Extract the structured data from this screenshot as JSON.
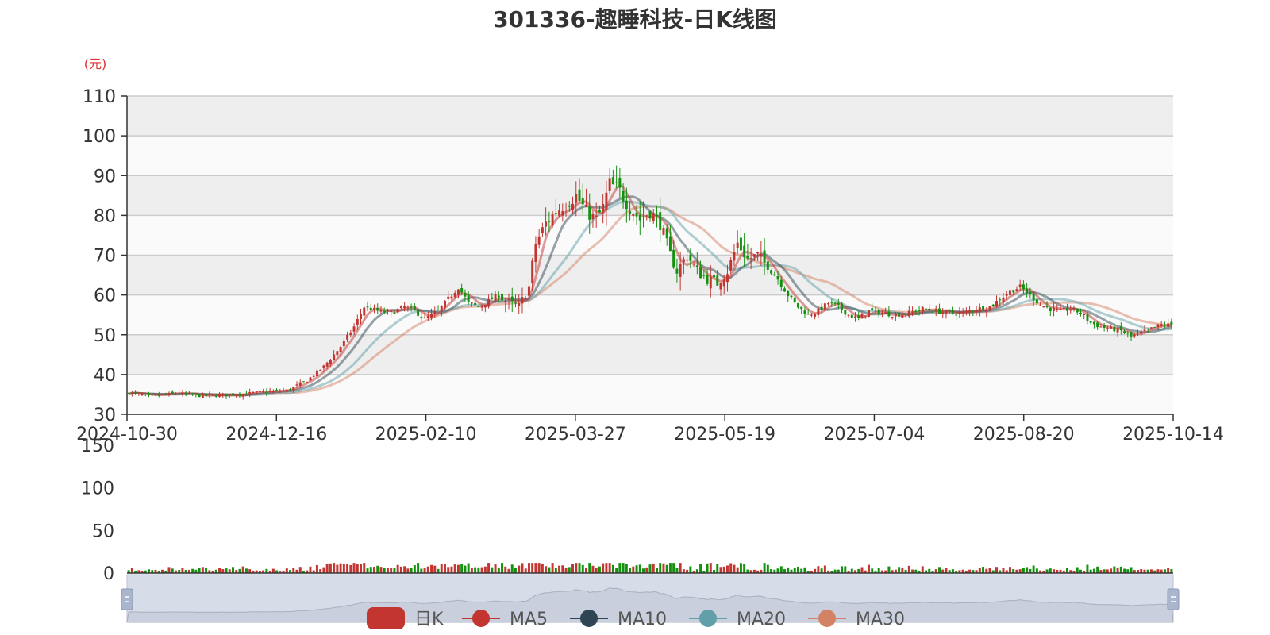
{
  "chart_data": {
    "type": "candlestick",
    "title": "301336-趣睡科技-日K线图",
    "yunit": "(元)",
    "ylim": [
      30,
      110
    ],
    "yticks": [
      30,
      40,
      50,
      60,
      70,
      80,
      90,
      100,
      110
    ],
    "x_ticks": [
      "2024-10-30",
      "2024-12-16",
      "2025-02-10",
      "2025-03-27",
      "2025-05-19",
      "2025-07-04",
      "2025-08-20",
      "2025-10-14"
    ],
    "volume_ylim": [
      0,
      150
    ],
    "volume_yticks": [
      0,
      50,
      100,
      150
    ],
    "legend": [
      "日K",
      "MA5",
      "MA10",
      "MA20",
      "MA30"
    ],
    "colors": {
      "up": "#c23531",
      "down": "#14910f",
      "ma5": "#c23531",
      "ma10": "#2f4554",
      "ma20": "#61a0a8",
      "ma30": "#d48265",
      "grid_band": "#eeeeee",
      "unit": "#e03030"
    },
    "price_anchors": [
      {
        "i": 0,
        "v": 35.5
      },
      {
        "i": 6,
        "v": 34.5
      },
      {
        "i": 14,
        "v": 35.3
      },
      {
        "i": 22,
        "v": 34.6
      },
      {
        "i": 32,
        "v": 35.0
      },
      {
        "i": 40,
        "v": 35.6
      },
      {
        "i": 47,
        "v": 36.0
      },
      {
        "i": 53,
        "v": 38.5
      },
      {
        "i": 58,
        "v": 42.0
      },
      {
        "i": 63,
        "v": 47.0
      },
      {
        "i": 67,
        "v": 52.0
      },
      {
        "i": 70,
        "v": 57.0
      },
      {
        "i": 74,
        "v": 56.0
      },
      {
        "i": 78,
        "v": 55.5
      },
      {
        "i": 82,
        "v": 57.0
      },
      {
        "i": 85,
        "v": 56.0
      },
      {
        "i": 88,
        "v": 54.0
      },
      {
        "i": 92,
        "v": 56.0
      },
      {
        "i": 95,
        "v": 59.0
      },
      {
        "i": 98,
        "v": 62.0
      },
      {
        "i": 101,
        "v": 58.0
      },
      {
        "i": 104,
        "v": 57.0
      },
      {
        "i": 107,
        "v": 58.5
      },
      {
        "i": 110,
        "v": 60.0
      },
      {
        "i": 113,
        "v": 58.0
      },
      {
        "i": 116,
        "v": 57.0
      },
      {
        "i": 119,
        "v": 62.0
      },
      {
        "i": 121,
        "v": 73.0
      },
      {
        "i": 124,
        "v": 78.0
      },
      {
        "i": 127,
        "v": 81.0
      },
      {
        "i": 130,
        "v": 83.0
      },
      {
        "i": 133,
        "v": 85.0
      },
      {
        "i": 136,
        "v": 81.0
      },
      {
        "i": 139,
        "v": 79.0
      },
      {
        "i": 141,
        "v": 82.0
      },
      {
        "i": 143,
        "v": 88.0
      },
      {
        "i": 146,
        "v": 86.0
      },
      {
        "i": 149,
        "v": 82.0
      },
      {
        "i": 152,
        "v": 79.0
      },
      {
        "i": 155,
        "v": 81.0
      },
      {
        "i": 158,
        "v": 78.0
      },
      {
        "i": 161,
        "v": 70.0
      },
      {
        "i": 163,
        "v": 66.0
      },
      {
        "i": 166,
        "v": 70.0
      },
      {
        "i": 169,
        "v": 66.0
      },
      {
        "i": 172,
        "v": 64.0
      },
      {
        "i": 175,
        "v": 63.0
      },
      {
        "i": 178,
        "v": 66.0
      },
      {
        "i": 181,
        "v": 73.0
      },
      {
        "i": 184,
        "v": 69.0
      },
      {
        "i": 187,
        "v": 70.0
      },
      {
        "i": 190,
        "v": 67.0
      },
      {
        "i": 193,
        "v": 64.0
      },
      {
        "i": 196,
        "v": 60.0
      },
      {
        "i": 199,
        "v": 57.0
      },
      {
        "i": 202,
        "v": 55.0
      },
      {
        "i": 205,
        "v": 56.0
      },
      {
        "i": 208,
        "v": 58.0
      },
      {
        "i": 211,
        "v": 57.0
      },
      {
        "i": 214,
        "v": 55.0
      },
      {
        "i": 217,
        "v": 54.0
      },
      {
        "i": 220,
        "v": 56.0
      },
      {
        "i": 224,
        "v": 55.5
      },
      {
        "i": 228,
        "v": 55.0
      },
      {
        "i": 232,
        "v": 55.5
      },
      {
        "i": 236,
        "v": 56.5
      },
      {
        "i": 240,
        "v": 56.0
      },
      {
        "i": 244,
        "v": 55.5
      },
      {
        "i": 248,
        "v": 55.5
      },
      {
        "i": 252,
        "v": 56.5
      },
      {
        "i": 256,
        "v": 57.0
      },
      {
        "i": 259,
        "v": 59.0
      },
      {
        "i": 262,
        "v": 61.0
      },
      {
        "i": 265,
        "v": 62.0
      },
      {
        "i": 268,
        "v": 60.0
      },
      {
        "i": 271,
        "v": 57.5
      },
      {
        "i": 274,
        "v": 56.5
      },
      {
        "i": 277,
        "v": 56.0
      },
      {
        "i": 280,
        "v": 56.5
      },
      {
        "i": 283,
        "v": 55.5
      },
      {
        "i": 286,
        "v": 53.0
      },
      {
        "i": 289,
        "v": 52.0
      },
      {
        "i": 292,
        "v": 51.5
      },
      {
        "i": 295,
        "v": 51.0
      },
      {
        "i": 298,
        "v": 49.5
      },
      {
        "i": 301,
        "v": 50.5
      },
      {
        "i": 304,
        "v": 51.5
      },
      {
        "i": 307,
        "v": 52.5
      },
      {
        "i": 310,
        "v": 52.5
      }
    ]
  }
}
